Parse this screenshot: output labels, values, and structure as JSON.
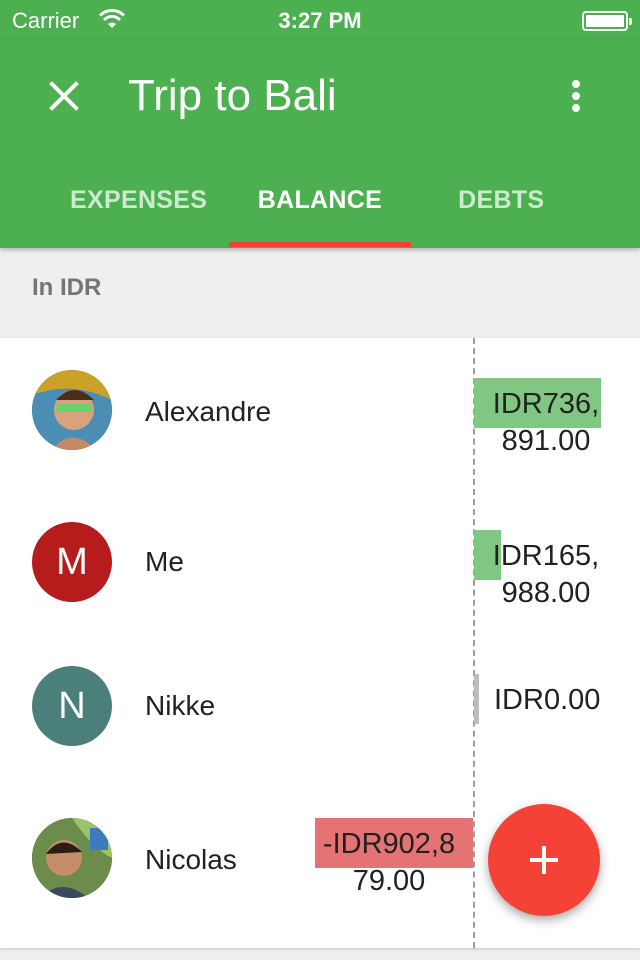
{
  "status_bar": {
    "carrier": "Carrier",
    "time": "3:27 PM"
  },
  "app_bar": {
    "title": "Trip to Bali"
  },
  "tabs": [
    {
      "label": "EXPENSES",
      "active": false
    },
    {
      "label": "BALANCE",
      "active": true
    },
    {
      "label": "DEBTS",
      "active": false
    }
  ],
  "currency_header": "In IDR",
  "members": [
    {
      "name": "Alexandre",
      "avatar": "photo",
      "amount": "IDR736,891.00",
      "balance": 736891.0
    },
    {
      "name": "Me",
      "avatar": "initial",
      "initial": "M",
      "avatar_color": "#b71c1c",
      "amount": "IDR165,988.00",
      "balance": 165988.0
    },
    {
      "name": "Nikke",
      "avatar": "initial",
      "initial": "N",
      "avatar_color": "#4a7f7a",
      "amount": "IDR0.00",
      "balance": 0.0
    },
    {
      "name": "Nicolas",
      "avatar": "photo",
      "amount": "-IDR902,879.00",
      "balance": -902879.0
    }
  ],
  "colors": {
    "primary": "#4caf50",
    "accent": "#f44336",
    "positive_bar": "#81c784",
    "negative_bar": "#e57373",
    "zero_bar": "#bdbdbd"
  },
  "icons": {
    "close": "close-icon",
    "more": "more-vert-icon",
    "fab": "plus-icon"
  }
}
